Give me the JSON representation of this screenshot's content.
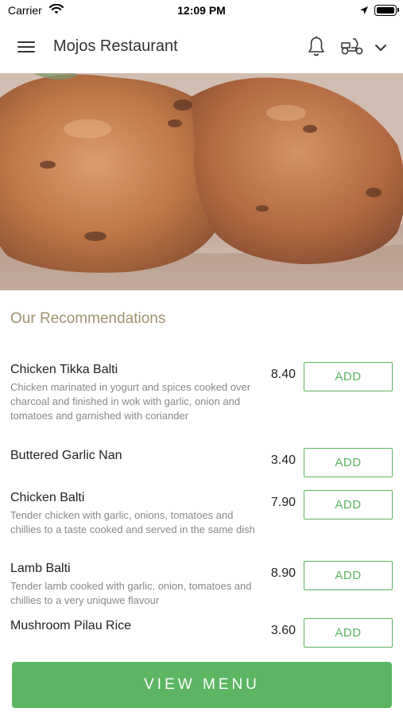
{
  "status_bar": {
    "carrier": "Carrier",
    "time": "12:09 PM"
  },
  "header": {
    "title": "Mojos Restaurant"
  },
  "recommendations": {
    "heading": "Our Recommendations",
    "items": [
      {
        "name": "Chicken Tikka Balti",
        "description": "Chicken marinated in yogurt and spices cooked over charcoal and finished in wok with garlic, onion and tomatoes and garnished with coriander",
        "price": "8.40",
        "button": "ADD"
      },
      {
        "name": "Buttered Garlic Nan",
        "description": "",
        "price": "3.40",
        "button": "ADD"
      },
      {
        "name": "Chicken Balti",
        "description": "Tender chicken with garlic, onions, tomatoes and chillies to a taste cooked and served in the same dish",
        "price": "7.90",
        "button": "ADD"
      },
      {
        "name": "Lamb Balti",
        "description": "Tender lamb cooked with garlic, onion, tomatoes and chillies to a very uniquwe flavour",
        "price": "8.90",
        "button": "ADD"
      },
      {
        "name": "Mushroom Pilau Rice",
        "description": "",
        "price": "3.60",
        "button": "ADD"
      }
    ]
  },
  "footer": {
    "view_menu_label": "VIEW MENU"
  },
  "colors": {
    "accent_green": "#5cb562",
    "heading_gold": "#a0926d"
  }
}
